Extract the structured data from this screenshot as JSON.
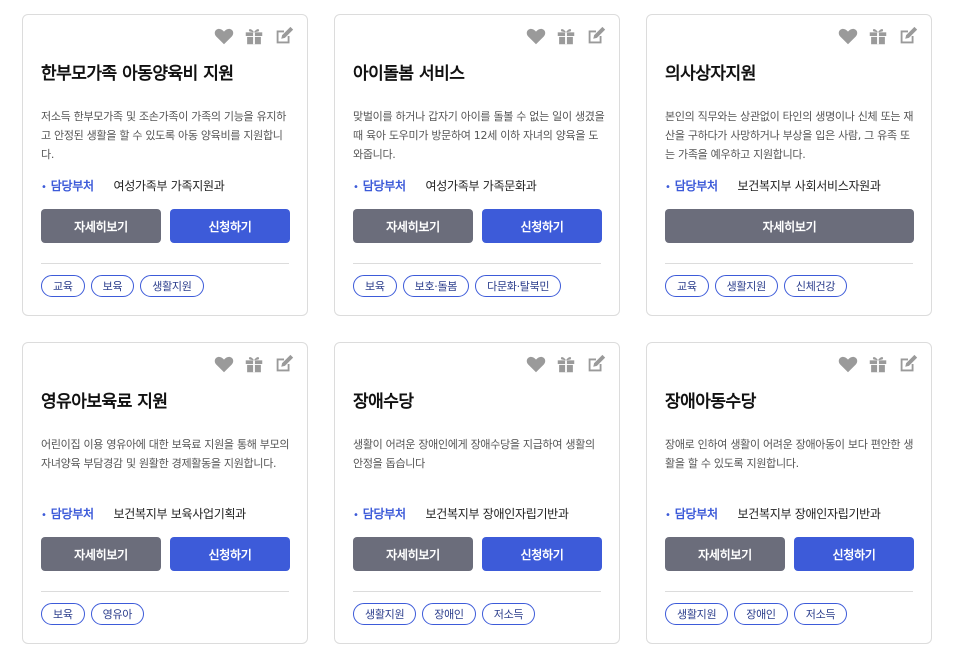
{
  "cards": [
    {
      "title": "한부모가족 아동양육비 지원",
      "desc": "저소득 한부모가족 및 조손가족이 가족의 기능을 유지하고 안정된 생활을 할 수 있도록 아동 양육비를 지원합니다.",
      "dept_label": "담당부처",
      "dept": "여성가족부 가족지원과",
      "detail_label": "자세히보기",
      "apply_label": "신청하기",
      "tags": [
        "교육",
        "보육",
        "생활지원"
      ]
    },
    {
      "title": "아이돌봄 서비스",
      "desc": "맞벌이를 하거나 갑자기 아이를 돌볼 수 없는 일이 생겼을 때 육아 도우미가 방문하여 12세 이하 자녀의 양육을 도와줍니다.",
      "dept_label": "담당부처",
      "dept": "여성가족부 가족문화과",
      "detail_label": "자세히보기",
      "apply_label": "신청하기",
      "tags": [
        "보육",
        "보호·돌봄",
        "다문화·탈북민"
      ]
    },
    {
      "title": "의사상자지원",
      "desc": "본인의 직무와는 상관없이 타인의 생명이나 신체 또는 재산을 구하다가 사망하거나 부상을 입은 사람, 그 유족 또는 가족을 예우하고 지원합니다.",
      "dept_label": "담당부처",
      "dept": "보건복지부 사회서비스자원과",
      "detail_label": "자세히보기",
      "apply_label": "",
      "tags": [
        "교육",
        "생활지원",
        "신체건강"
      ]
    },
    {
      "title": "영유아보육료 지원",
      "desc": "어린이집 이용 영유아에 대한 보육료 지원을 통해 부모의 자녀양육 부담경감 및 원활한 경제활동을 지원합니다.",
      "dept_label": "담당부처",
      "dept": "보건복지부 보육사업기획과",
      "detail_label": "자세히보기",
      "apply_label": "신청하기",
      "tags": [
        "보육",
        "영유아"
      ]
    },
    {
      "title": "장애수당",
      "desc": "생활이 어려운 장애인에게 장애수당을 지급하여 생활의 안정을 돕습니다",
      "dept_label": "담당부처",
      "dept": "보건복지부 장애인자립기반과",
      "detail_label": "자세히보기",
      "apply_label": "신청하기",
      "tags": [
        "생활지원",
        "장애인",
        "저소득"
      ]
    },
    {
      "title": "장애아동수당",
      "desc": "장애로 인하여 생활이 어려운 장애아동이 보다 편안한 생활을 할 수 있도록 지원합니다.",
      "dept_label": "담당부처",
      "dept": "보건복지부 장애인자립기반과",
      "detail_label": "자세히보기",
      "apply_label": "신청하기",
      "tags": [
        "생활지원",
        "장애인",
        "저소득"
      ]
    }
  ],
  "icons": [
    "heart-icon",
    "gift-icon",
    "edit-icon"
  ],
  "colors": {
    "accent": "#3d5bd9",
    "secondary": "#6b6d7b",
    "icon": "#9a9a9a",
    "border": "#dcdcdc"
  }
}
